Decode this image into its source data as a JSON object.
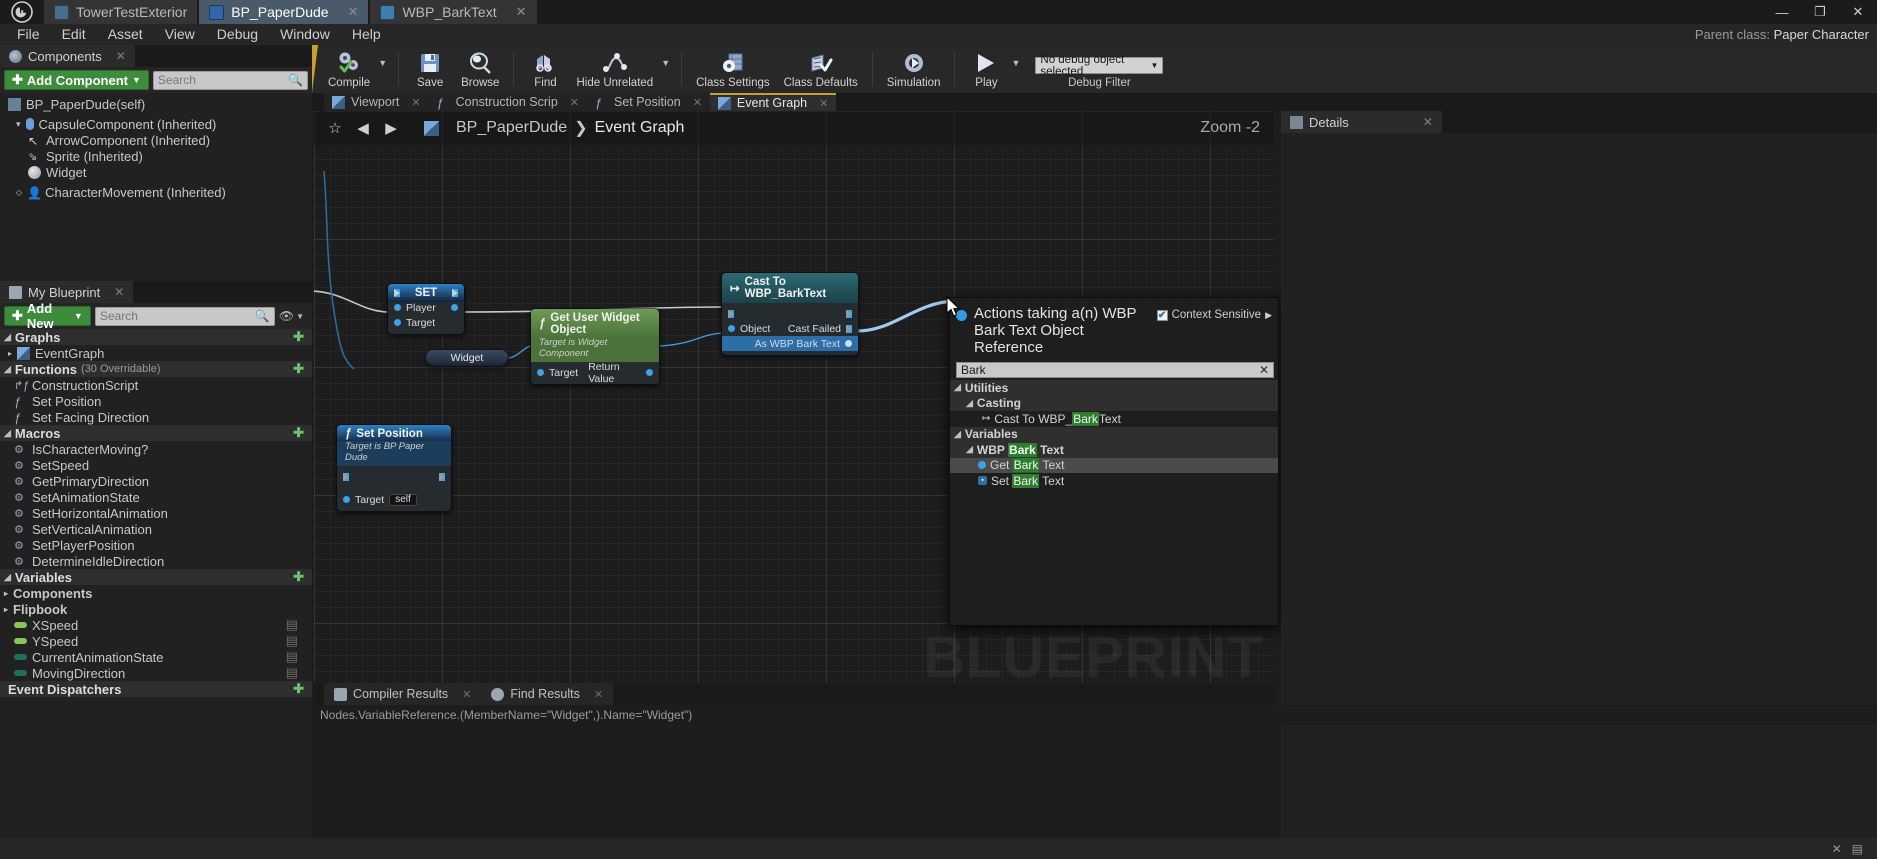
{
  "window": {
    "tabs": [
      {
        "label": "TowerTestExterior",
        "icon": "level-icon",
        "active": false,
        "closable": false
      },
      {
        "label": "BP_PaperDude",
        "icon": "blueprint-icon",
        "active": true,
        "closable": true
      },
      {
        "label": "WBP_BarkText",
        "icon": "widget-blueprint-icon",
        "active": false,
        "closable": true
      }
    ],
    "controls": [
      "minimize",
      "maximize",
      "close"
    ]
  },
  "menubar": {
    "items": [
      "File",
      "Edit",
      "Asset",
      "View",
      "Debug",
      "Window",
      "Help"
    ],
    "parent_class_label": "Parent class:",
    "parent_class_value": "Paper Character"
  },
  "components_panel": {
    "tab_label": "Components",
    "add_button": "Add Component",
    "search_placeholder": "Search",
    "root": "BP_PaperDude(self)",
    "tree": [
      {
        "label": "CapsuleComponent (Inherited)",
        "depth": 1,
        "icon": "capsule-icon",
        "expander": "down"
      },
      {
        "label": "ArrowComponent (Inherited)",
        "depth": 2,
        "icon": "arrow-icon",
        "expander": ""
      },
      {
        "label": "Sprite (Inherited)",
        "depth": 2,
        "icon": "sprite-icon",
        "expander": ""
      },
      {
        "label": "Widget",
        "depth": 2,
        "icon": "widget-icon",
        "expander": ""
      },
      {
        "label": "CharacterMovement (Inherited)",
        "depth": 1,
        "icon": "charmove-icon",
        "expander": "right"
      }
    ]
  },
  "my_blueprint_panel": {
    "tab_label": "My Blueprint",
    "add_button": "Add New",
    "search_placeholder": "Search",
    "sections": [
      {
        "title": "Graphs",
        "suffix": "",
        "expander": "down",
        "add": true,
        "items": [
          {
            "label": "EventGraph",
            "icon": "graph-icon",
            "expander": "right"
          }
        ]
      },
      {
        "title": "Functions",
        "suffix": "(30 Overridable)",
        "expander": "down",
        "add": true,
        "items": [
          {
            "label": "ConstructionScript",
            "icon": "construction-script-icon",
            "expander": ""
          },
          {
            "label": "Set Position",
            "icon": "function-icon",
            "expander": ""
          },
          {
            "label": "Set Facing Direction",
            "icon": "function-icon",
            "expander": ""
          }
        ]
      },
      {
        "title": "Macros",
        "suffix": "",
        "expander": "down",
        "add": true,
        "items": [
          {
            "label": "IsCharacterMoving?",
            "icon": "macro-icon",
            "expander": ""
          },
          {
            "label": "SetSpeed",
            "icon": "macro-icon",
            "expander": ""
          },
          {
            "label": "GetPrimaryDirection",
            "icon": "macro-icon",
            "expander": ""
          },
          {
            "label": "SetAnimationState",
            "icon": "macro-icon",
            "expander": ""
          },
          {
            "label": "SetHorizontalAnimation",
            "icon": "macro-icon",
            "expander": ""
          },
          {
            "label": "SetVerticalAnimation",
            "icon": "macro-icon",
            "expander": ""
          },
          {
            "label": "SetPlayerPosition",
            "icon": "macro-icon",
            "expander": ""
          },
          {
            "label": "DetermineIdleDirection",
            "icon": "macro-icon",
            "expander": ""
          }
        ]
      },
      {
        "title": "Variables",
        "suffix": "",
        "expander": "down",
        "add": true,
        "items": [
          {
            "label": "Components",
            "icon": "",
            "expander": "right",
            "bold": true
          },
          {
            "label": "Flipbook",
            "icon": "",
            "expander": "right",
            "bold": true
          },
          {
            "label": "XSpeed",
            "icon": "var-float-icon",
            "expander": "",
            "color": "#7fc45a"
          },
          {
            "label": "YSpeed",
            "icon": "var-float-icon",
            "expander": "",
            "color": "#7fc45a"
          },
          {
            "label": "CurrentAnimationState",
            "icon": "var-enum-icon",
            "expander": "",
            "color": "#1e6c5e"
          },
          {
            "label": "MovingDirection",
            "icon": "var-enum-icon",
            "expander": "",
            "color": "#1e6c5e"
          }
        ]
      },
      {
        "title": "Event Dispatchers",
        "suffix": "",
        "expander": "",
        "add": true,
        "items": []
      }
    ]
  },
  "toolbar": {
    "groups": [
      {
        "items": [
          {
            "label": "Compile",
            "icon": "compile-icon",
            "caret": true
          }
        ]
      },
      {
        "items": [
          {
            "label": "Save",
            "icon": "save-icon",
            "caret": false
          },
          {
            "label": "Browse",
            "icon": "browse-icon",
            "caret": false
          }
        ]
      },
      {
        "items": [
          {
            "label": "Find",
            "icon": "find-icon",
            "caret": false
          },
          {
            "label": "Hide Unrelated",
            "icon": "hide-unrelated-icon",
            "caret": true
          }
        ]
      },
      {
        "items": [
          {
            "label": "Class Settings",
            "icon": "class-settings-icon",
            "caret": false
          },
          {
            "label": "Class Defaults",
            "icon": "class-defaults-icon",
            "caret": false
          }
        ]
      },
      {
        "items": [
          {
            "label": "Simulation",
            "icon": "simulation-icon",
            "caret": false
          }
        ]
      },
      {
        "items": [
          {
            "label": "Play",
            "icon": "play-icon",
            "caret": true
          }
        ]
      }
    ],
    "debug_filter_value": "No debug object selected",
    "debug_filter_label": "Debug Filter"
  },
  "document_tabs": [
    {
      "label": "Viewport",
      "icon": "viewport-icon",
      "active": false
    },
    {
      "label": "Construction Scrip",
      "icon": "function-icon",
      "active": false
    },
    {
      "label": "Set Position",
      "icon": "function-icon",
      "active": false
    },
    {
      "label": "Event Graph",
      "icon": "graph-icon",
      "active": true
    }
  ],
  "graph": {
    "breadcrumb": [
      "BP_PaperDude",
      "Event Graph"
    ],
    "zoom_label": "Zoom -2",
    "watermark": "BLUEPRINT",
    "toolbar_icons": [
      "bookmark-star-icon",
      "back-arrow-icon",
      "forward-arrow-icon",
      "graph-icon"
    ],
    "nodes": [
      {
        "id": "set",
        "title": "SET",
        "subtitle": "",
        "inputs": [
          "Player",
          "Target"
        ],
        "outputs": []
      },
      {
        "id": "widget",
        "title": "Widget",
        "subtitle": "",
        "inputs": [],
        "outputs": []
      },
      {
        "id": "get_user_widget",
        "title": "Get User Widget Object",
        "subtitle": "Target is Widget Component",
        "inputs": [
          "Target"
        ],
        "outputs": [
          "Return Value"
        ]
      },
      {
        "id": "cast",
        "title": "Cast To WBP_BarkText",
        "subtitle": "",
        "inputs": [
          "Object"
        ],
        "outputs": [
          "Cast Failed",
          "As WBP Bark Text"
        ]
      },
      {
        "id": "set_position",
        "title": "Set Position",
        "subtitle": "Target is BP Paper Dude",
        "inputs": [
          "Target"
        ],
        "target_value": "self"
      }
    ]
  },
  "context_menu": {
    "title": "Actions taking a(n) WBP Bark Text Object Reference",
    "context_sensitive_label": "Context Sensitive",
    "context_sensitive_checked": true,
    "search_value": "Bark",
    "items": [
      {
        "label": "Utilities",
        "kind": "category",
        "depth": 0,
        "expander": "down"
      },
      {
        "label": "Casting",
        "kind": "category",
        "depth": 1,
        "expander": "down"
      },
      {
        "label": "Cast To WBP_BarkText",
        "kind": "action",
        "depth": 2,
        "icon": "cast-icon",
        "highlight": "Bark"
      },
      {
        "label": "Variables",
        "kind": "category",
        "depth": 0,
        "expander": "down"
      },
      {
        "label": "WBP Bark Text",
        "kind": "category",
        "depth": 1,
        "expander": "down"
      },
      {
        "label": "Get Bark Text",
        "kind": "action",
        "depth": 2,
        "icon": "get-var-icon",
        "highlight": "Bark",
        "selected": true
      },
      {
        "label": "Set Bark Text",
        "kind": "action",
        "depth": 2,
        "icon": "set-var-icon",
        "highlight": "Bark"
      }
    ]
  },
  "details_panel": {
    "tab_label": "Details"
  },
  "bottom": {
    "tabs": [
      {
        "label": "Compiler Results",
        "icon": "compiler-results-icon"
      },
      {
        "label": "Find Results",
        "icon": "find-results-icon"
      }
    ],
    "status_text": "Nodes.VariableReference.(MemberName=\"Widget\",).Name=\"Widget\")"
  }
}
